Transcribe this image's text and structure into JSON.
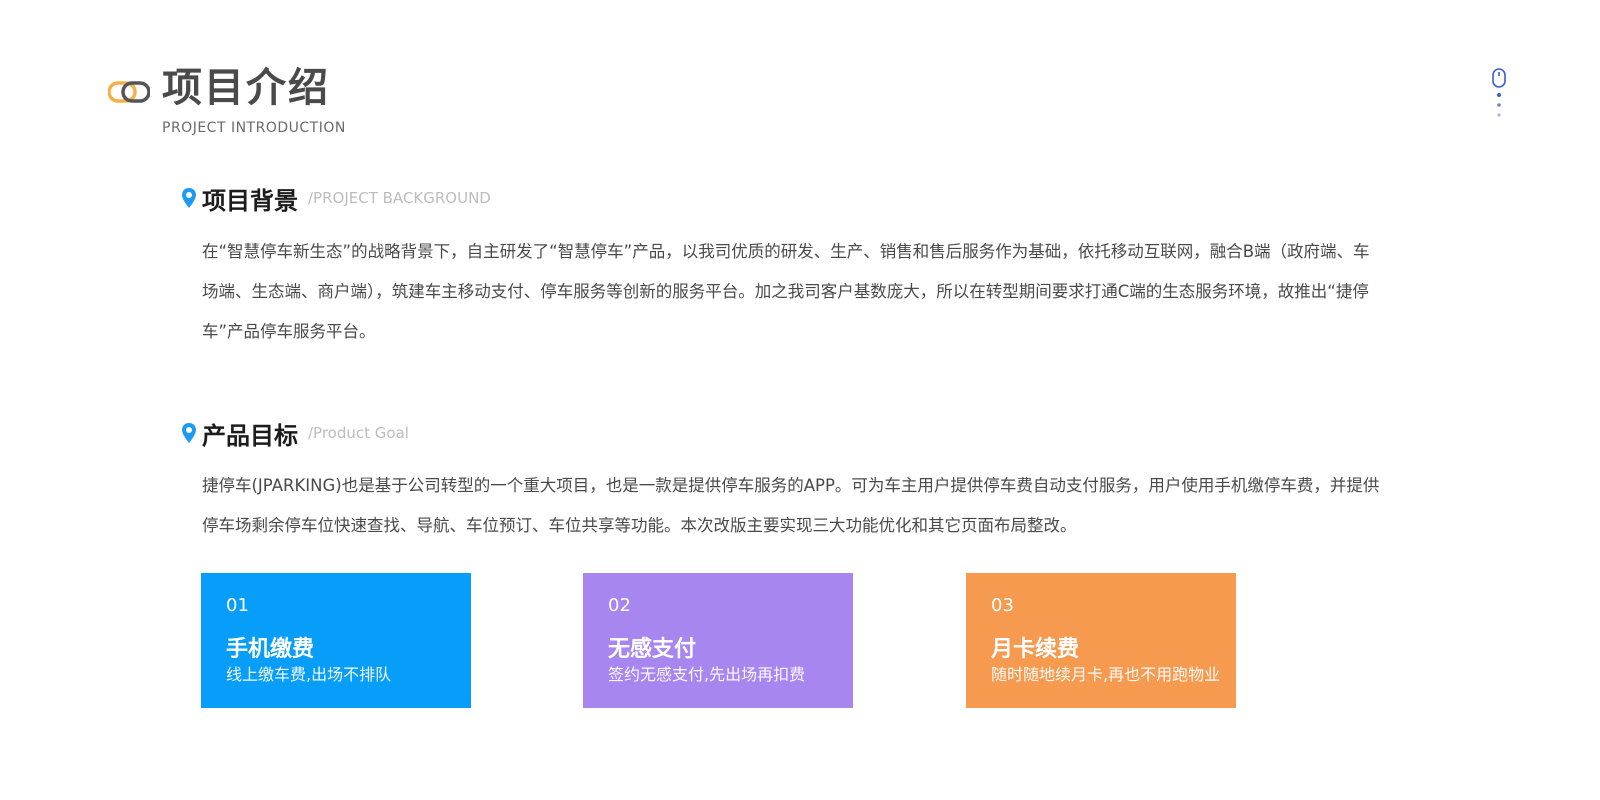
{
  "header": {
    "title": "项目介绍",
    "subtitle": "PROJECT INTRODUCTION",
    "logo_colors": [
      "#f5b04a",
      "#555555"
    ],
    "scroll_icon": "mouse-scroll-icon"
  },
  "sections": {
    "background": {
      "title": "项目背景",
      "title_en": "/PROJECT BACKGROUND",
      "icon": "location-pin-icon",
      "text": "在“智慧停车新生态”的战略背景下，自主研发了“智慧停车”产品，以我司优质的研发、生产、销售和售后服务作为基础，依托移动互联网，融合B端（政府端、车场端、生态端、商户端），筑建车主移动支付、停车服务等创新的服务平台。加之我司客户基数庞大，所以在转型期间要求打通C端的生态服务环境，故推出“捷停车”产品停车服务平台。"
    },
    "goal": {
      "title": "产品目标",
      "title_en": "/Product Goal",
      "icon": "location-pin-icon",
      "text": "捷停车(JPARKING)也是基于公司转型的一个重大项目，也是一款是提供停车服务的APP。可为车主用户提供停车费自动支付服务，用户使用手机缴停车费，并提供停车场剩余停车位快速查找、导航、车位预订、车位共享等功能。本次改版主要实现三大功能优化和其它页面布局整改。"
    }
  },
  "cards": [
    {
      "num": "01",
      "title": "手机缴费",
      "desc": "线上缴车费,出场不排队",
      "color": "#079ef9"
    },
    {
      "num": "02",
      "title": "无感支付",
      "desc": "签约无感支付,先出场再扣费",
      "color": "#a886f0"
    },
    {
      "num": "03",
      "title": "月卡续费",
      "desc": "随时随地续月卡,再也不用跑物业",
      "color": "#f59a4e"
    }
  ],
  "colors": {
    "accent_blue": "#1a8ff5",
    "pin_blue": "#1d9af2"
  }
}
